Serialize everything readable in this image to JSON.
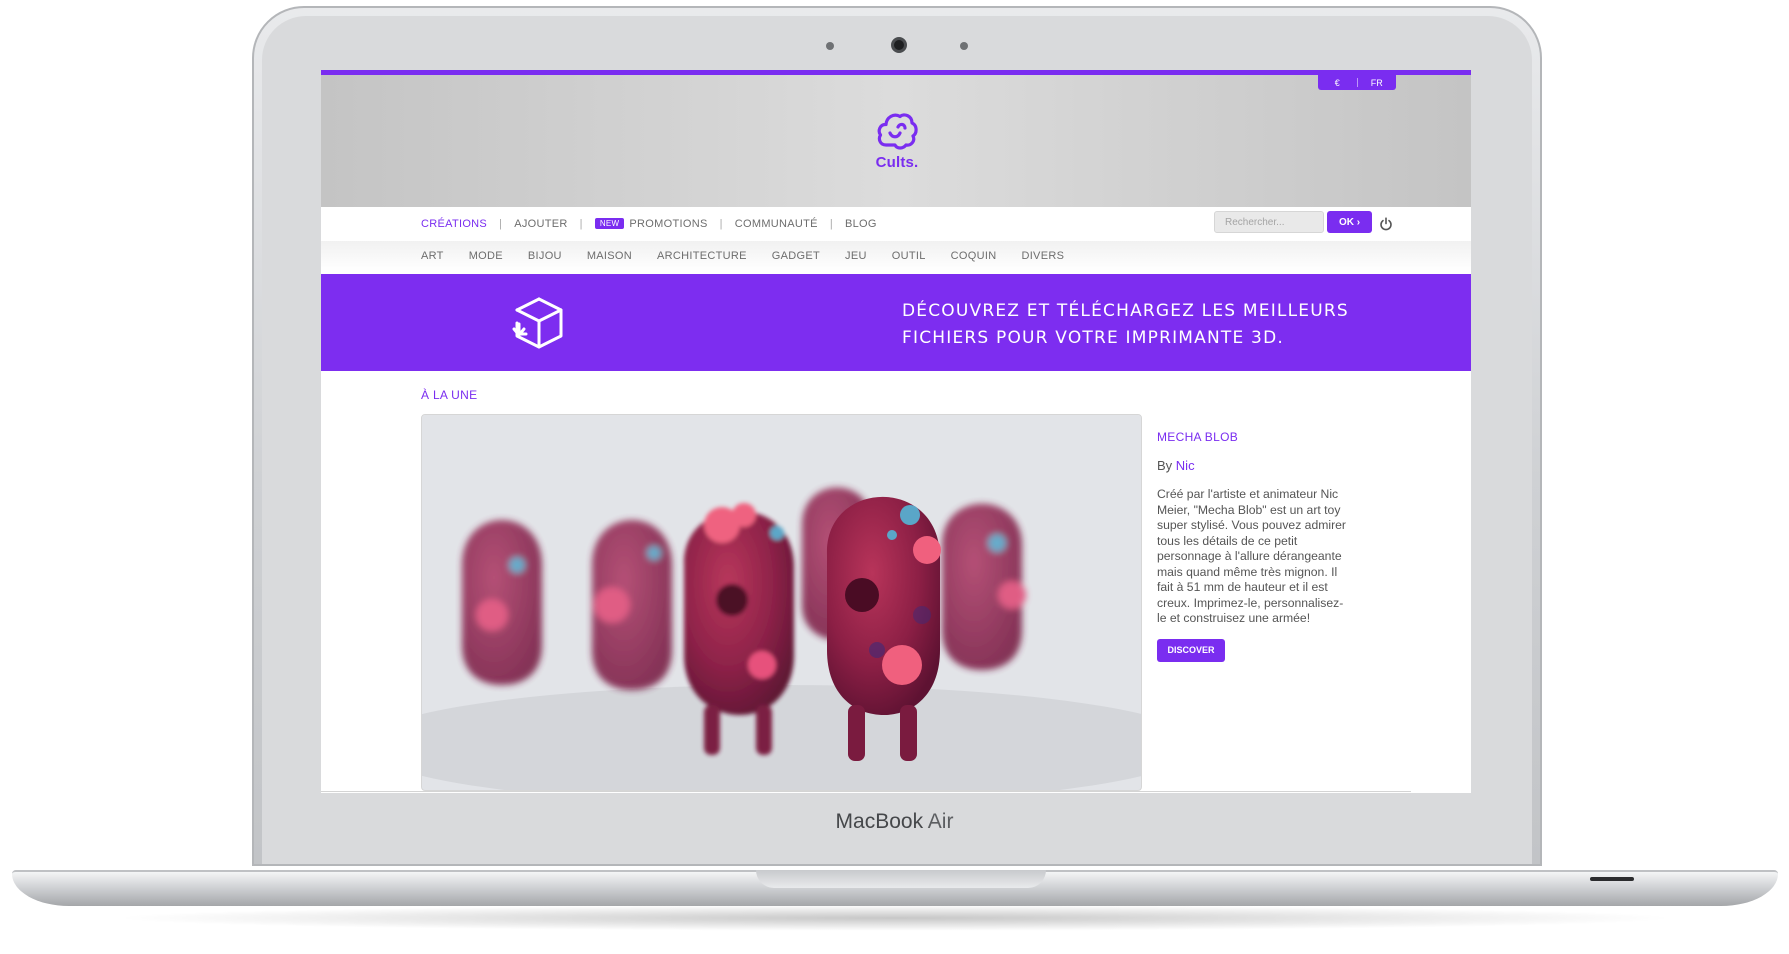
{
  "device": {
    "brand_label": "MacBook",
    "model_label": "Air"
  },
  "site": {
    "currency": "€",
    "language": "FR",
    "logo_text": "Cults."
  },
  "nav": {
    "items": [
      {
        "label": "CRÉATIONS",
        "active": true
      },
      {
        "label": "AJOUTER"
      },
      {
        "badge": "NEW",
        "label": "PROMOTIONS"
      },
      {
        "label": "COMMUNAUTÉ"
      },
      {
        "label": "BLOG"
      }
    ]
  },
  "search": {
    "placeholder": "Rechercher...",
    "button_label": "OK",
    "button_icon": "chevron-right-icon"
  },
  "categories": [
    "ART",
    "MODE",
    "BIJOU",
    "MAISON",
    "ARCHITECTURE",
    "GADGET",
    "JEU",
    "OUTIL",
    "COQUIN",
    "DIVERS"
  ],
  "banner": {
    "line1": "DÉCOUVREZ ET TÉLÉCHARGEZ LES MEILLEURS",
    "line2": "FICHIERS POUR VOTRE IMPRIMANTE 3D.",
    "icon": "download-box-icon"
  },
  "featured": {
    "section_title": "À LA UNE",
    "title": "MECHA BLOB",
    "by_label": "By",
    "author": "Nic",
    "description": "Créé par l'artiste et animateur Nic Meier, \"Mecha Blob\" est un art toy super stylisé. Vous pouvez admirer tous les détails de ce petit personnage à l'allure dérangeante mais quand même très mignon. Il fait à 51 mm de hauteur et il est creux. Imprimez-le, personnalisez-le et construisez une armée!",
    "button_label": "DISCOVER"
  },
  "colors": {
    "accent": "#7a2df0",
    "header_gray": "#c8c8c8",
    "text_gray": "#555555"
  }
}
